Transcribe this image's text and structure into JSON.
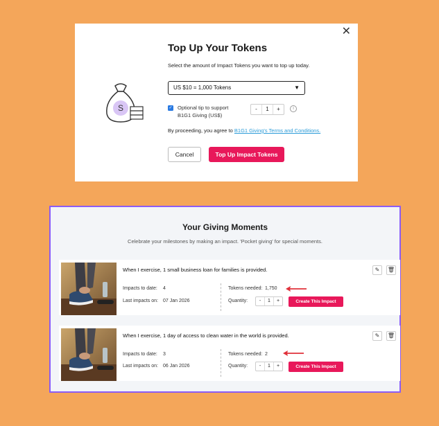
{
  "modal": {
    "title": "Top Up Your Tokens",
    "subtitle": "Select the amount of Impact Tokens you want to top up today.",
    "select_value": "US $10 = 1,000 Tokens",
    "tip_label_line1": "Optional tip to support",
    "tip_label_line2": "B1G1 Giving (US$)",
    "tip_quantity": "1",
    "terms_prefix": "By proceeding, you agree to ",
    "terms_link": "B1G1 Giving's Terms and Conditions.",
    "cancel_label": "Cancel",
    "topup_label": "Top Up Impact Tokens",
    "close_glyph": "✕",
    "bag_symbol": "S",
    "tip_checked": true
  },
  "panel": {
    "title": "Your Giving Moments",
    "subtitle": "Celebrate your milestones by making an impact. 'Pocket giving' for special moments.",
    "impacts_label": "Impacts to date:",
    "last_label": "Last impacts on:",
    "tokens_label": "Tokens needed:",
    "quantity_label": "Quantity:",
    "create_label": "Create This Impact",
    "cards": [
      {
        "description": "When I exercise, 1 small business loan for families is provided.",
        "impacts": "4",
        "last_date": "07 Jan 2026",
        "tokens_needed": "1,750",
        "quantity": "1"
      },
      {
        "description": "When I exercise, 1 day of access to clean water in the world is provided.",
        "impacts": "3",
        "last_date": "06 Jan 2026",
        "tokens_needed": "2",
        "quantity": "1"
      }
    ]
  },
  "colors": {
    "background": "#F4A65A",
    "accent": "#E8185A",
    "panel_border": "#8B5CF6",
    "link": "#2a9bd8"
  }
}
